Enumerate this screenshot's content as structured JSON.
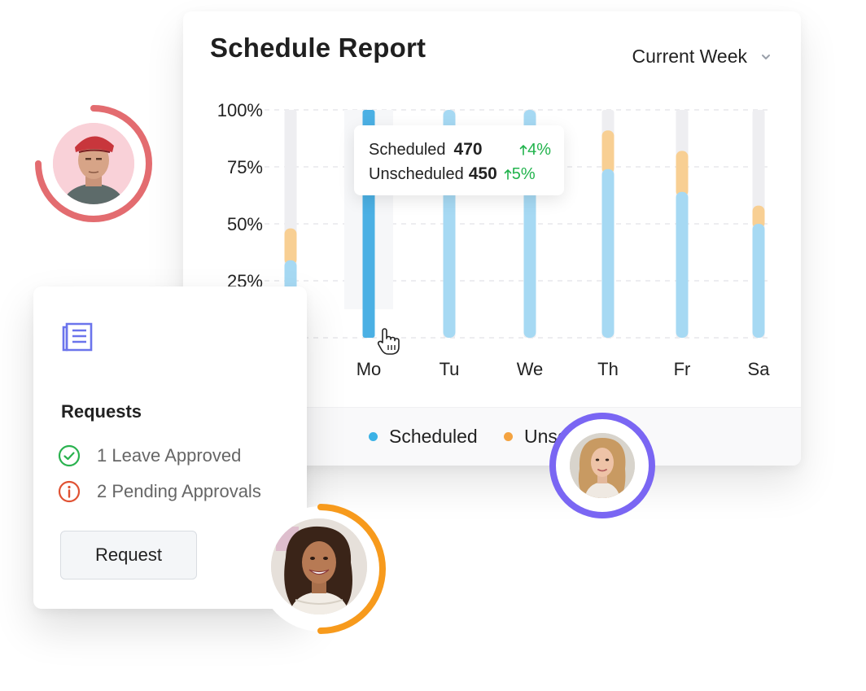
{
  "report": {
    "title": "Schedule Report",
    "period_selector": "Current Week"
  },
  "tooltip": {
    "scheduled_label": "Scheduled",
    "scheduled_value": "470",
    "scheduled_delta": "4%",
    "unscheduled_label": "Unscheduled",
    "unscheduled_value": "450",
    "unscheduled_delta": "5%"
  },
  "legend": {
    "scheduled": "Scheduled",
    "unscheduled": "Unscheduled"
  },
  "requests": {
    "title": "Requests",
    "items": [
      {
        "text": "1 Leave Approved",
        "icon": "check-circle-icon",
        "color": "#2ab24f"
      },
      {
        "text": "2 Pending Approvals",
        "icon": "info-circle-icon",
        "color": "#e05233"
      }
    ],
    "button_label": "Request"
  },
  "colors": {
    "scheduled": "#a6d9f3",
    "scheduled_active": "#4bb0e4",
    "unscheduled": "#f8cf93",
    "track": "#eeeef1",
    "legend_scheduled": "#3bb2e6",
    "legend_unscheduled": "#f4a340",
    "accent_red": "#e36c70",
    "accent_purple": "#7a66f3",
    "accent_orange": "#f79a1c",
    "positive": "#21b34c"
  },
  "chart_data": {
    "type": "bar",
    "stacked": true,
    "categories": [
      "Mo",
      "Tu",
      "We",
      "Th",
      "Fr",
      "Sa"
    ],
    "y_ticks": [
      "100%",
      "75%",
      "50%",
      "25%"
    ],
    "ylim": [
      0,
      100
    ],
    "grid": true,
    "active_category": "Mo",
    "series": [
      {
        "name": "Scheduled",
        "values": [
          34,
          100,
          100,
          100,
          74,
          64,
          50
        ]
      },
      {
        "name": "Unscheduled",
        "values": [
          14,
          0,
          0,
          0,
          17,
          18,
          8
        ]
      }
    ],
    "all_categories": [
      "",
      "Mo",
      "Tu",
      "We",
      "Th",
      "Fr",
      "Sa"
    ]
  }
}
